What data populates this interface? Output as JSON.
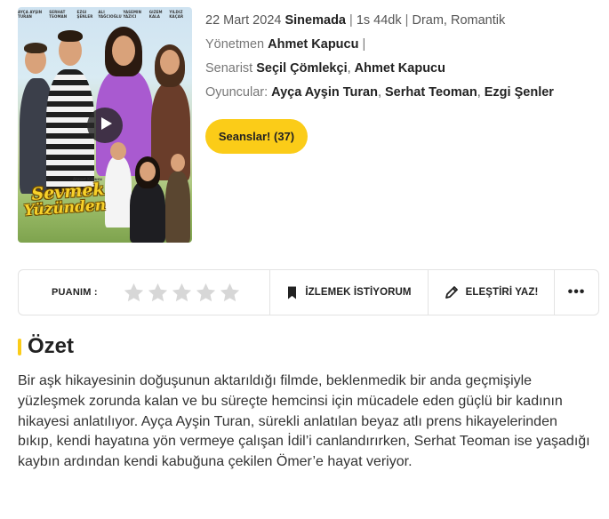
{
  "poster": {
    "credits": [
      "Ayça Ayşin Turan",
      "Serhat Teoman",
      "Ezgi Şenler",
      "Ali Yağcıoğlu",
      "Yasemin Yazıcı",
      "Gizem Kala",
      "Yıldız Kaçar"
    ],
    "title_line1": "Sevmek",
    "title_line2": "Yüzünden",
    "director_caption": "Ahmet Kapucu",
    "play_icon": "play-icon"
  },
  "info": {
    "date": "22 Mart 2024",
    "status": "Sinemada",
    "duration": "1s 44dk",
    "genres": "Dram, Romantik",
    "sep": "|",
    "director_label": "Yönetmen",
    "director": "Ahmet Kapucu",
    "writer_label": "Senarist",
    "writers": [
      "Seçil Çömlekçi",
      "Ahmet Kapucu"
    ],
    "cast_label": "Oyuncular:",
    "cast": [
      "Ayça Ayşin Turan",
      "Serhat Teoman",
      "Ezgi Şenler"
    ],
    "comma": ","
  },
  "seanslar_button": "Seanslar! (37)",
  "action_bar": {
    "rating_label": "PUANIM :",
    "star_icon": "star-icon",
    "stars_count": 5,
    "rating_value": 0,
    "watchlist_label": "İZLEMEK İSTİYORUM",
    "watchlist_icon": "bookmark-icon",
    "critic_label": "ELEŞTİRİ YAZ!",
    "critic_icon": "pencil-icon",
    "more_label": "•••",
    "more_icon": "more-dots-icon"
  },
  "summary": {
    "title": "Özet",
    "text": "Bir aşk hikayesinin doğuşunun aktarıldığı filmde, beklenmedik bir anda geçmişiyle yüzleşmek zorunda kalan ve bu süreçte hemcinsi için mücadele eden güçlü bir kadının hikayesi anlatılıyor. Ayça Ayşin Turan, sürekli anlatılan beyaz atlı prens hikayelerinden bıkıp, kendi hayatına yön vermeye çalışan İdil’i canlandırırken, Serhat Teoman ise yaşadığı kaybın ardından kendi kabuğuna çekilen Ömer’e hayat veriyor."
  },
  "colors": {
    "accent": "#fbcc18",
    "star_empty": "#d7d7d7",
    "border": "#e3e3e3"
  }
}
